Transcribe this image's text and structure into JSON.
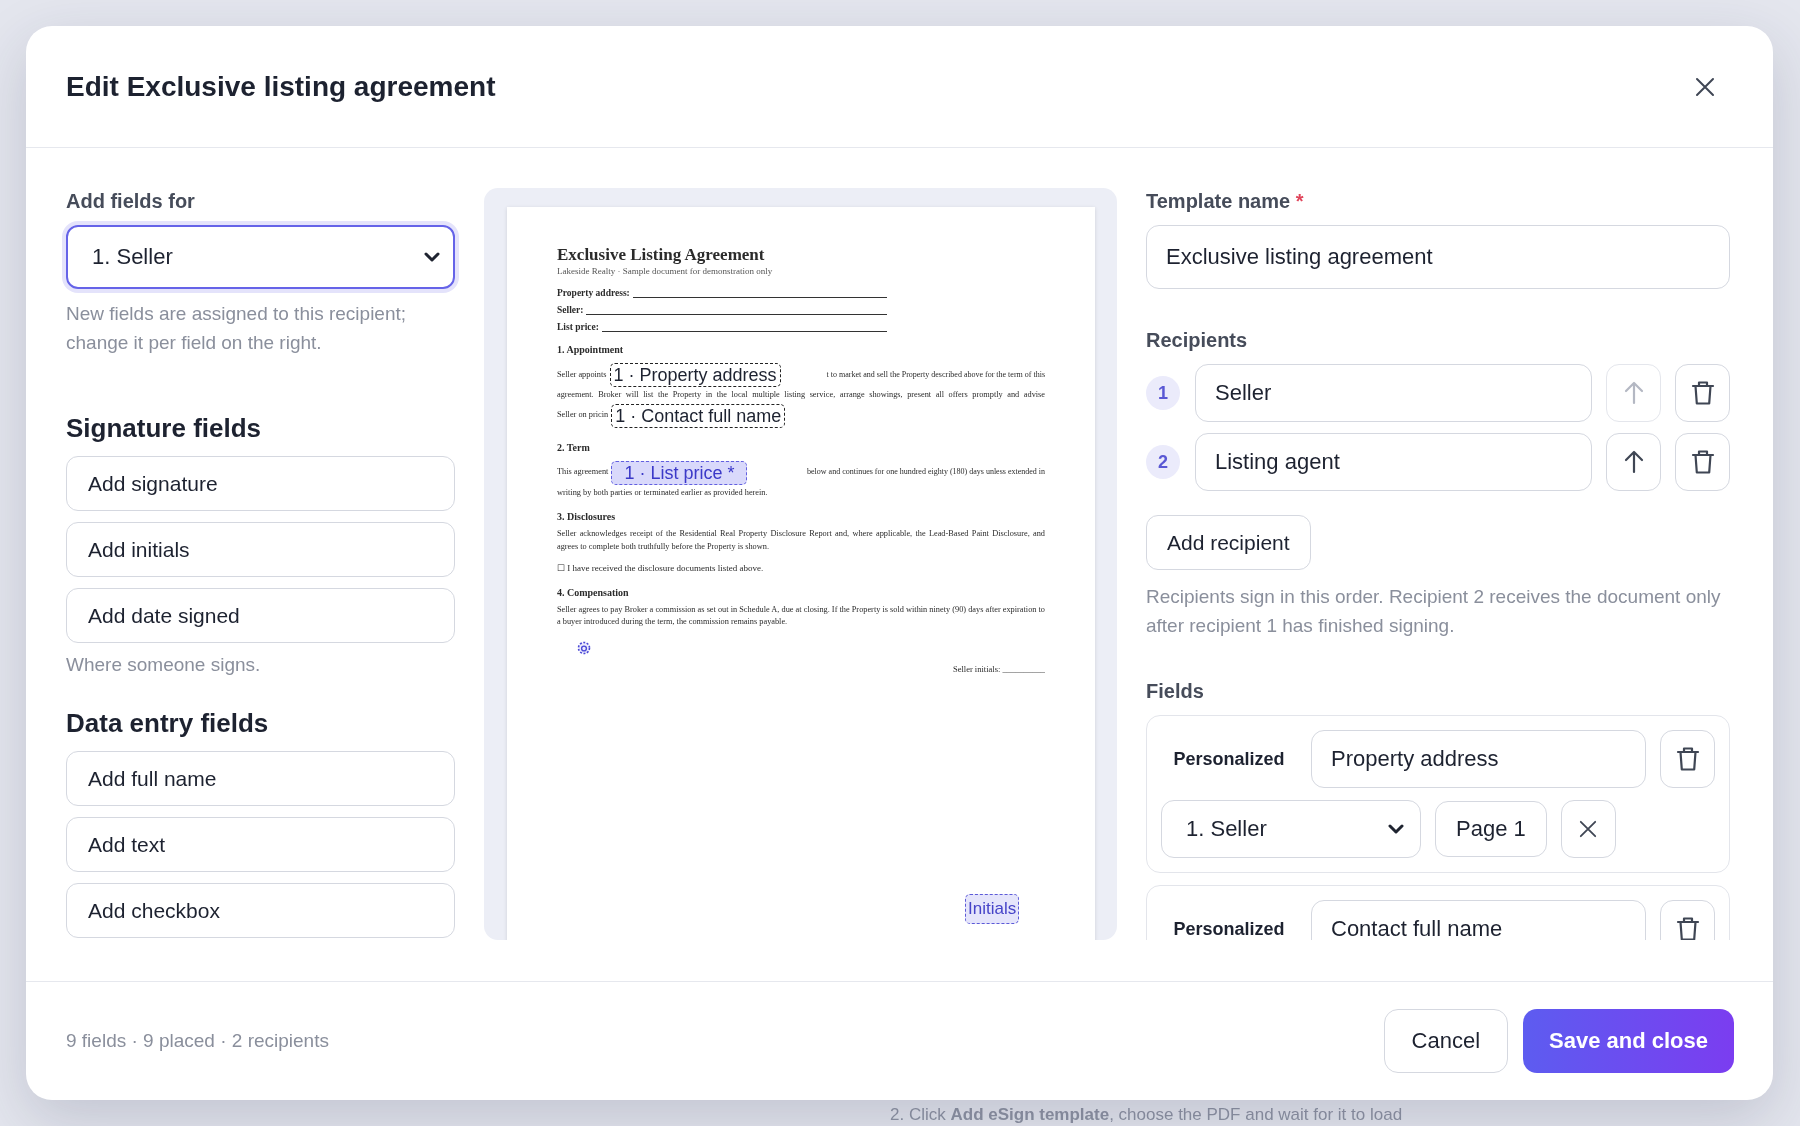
{
  "background": {
    "instruction": "2. Click **Add eSign template**, choose the PDF and wait for it to load"
  },
  "dialog": {
    "title": "Edit Exclusive listing agreement"
  },
  "left_panel": {
    "recipient_label": "Add fields for",
    "recipient_select": "1. Seller",
    "hint": "New fields are assigned to this recipient; change it per field on the right.",
    "sections": [
      {
        "heading": "Signature fields",
        "buttons": [
          "Add signature",
          "Add initials",
          "Add date signed"
        ],
        "note": "Where someone signs."
      },
      {
        "heading": "Data entry fields",
        "buttons": [
          "Add full name",
          "Add text",
          "Add checkbox"
        ]
      }
    ]
  },
  "document": {
    "title": "Exclusive Listing Agreement",
    "subtitle": "Lakeside Realty · Sample document for demonstration only",
    "blanks": [
      "Property address:",
      "Seller:",
      "List price:"
    ],
    "sections": [
      {
        "heading": "1. Appointment",
        "lines": [
          {
            "segments": [
              "Seller appoints",
              "t to market and sell the Property described above for the term of this"
            ],
            "placed_field": {
              "kind": "text",
              "label": "1 · Property address",
              "selected": false
            }
          },
          {
            "segments": [
              "agreement. Broker will list the Property in the local multiple listing service, arrange showings, present all offers promptly and advise"
            ]
          },
          {
            "segments": [
              "Seller on pricin"
            ],
            "placed_field": {
              "kind": "text",
              "label": "1 · Contact full name",
              "selected": false
            }
          }
        ]
      },
      {
        "heading": "2. Term",
        "lines": [
          {
            "segments": [
              "This agreement",
              "below and continues for one hundred eighty (180) days unless extended in"
            ],
            "placed_field": {
              "kind": "text",
              "label": "1 · List price *",
              "selected": true
            }
          },
          {
            "segments": [
              "writing by both parties or terminated earlier as provided herein."
            ]
          }
        ]
      },
      {
        "heading": "3. Disclosures",
        "paragraph": "Seller acknowledges receipt of the Residential Real Property Disclosure Report and, where applicable, the Lead-Based Paint Disclosure, and agrees to complete both truthfully before the Property is shown.",
        "checkbox_line": "☐ I have received the disclosure documents listed above."
      },
      {
        "heading": "4. Compensation",
        "paragraph": "Seller agrees to pay Broker a commission as set out in Schedule A, due at closing. If the Property is sold within ninety (90) days after expiration to a buyer introduced during the term, the commission remains payable."
      }
    ],
    "signature_line": "Seller initials: __________",
    "placed_fields": [
      {
        "kind": "marker",
        "selected": false
      },
      {
        "kind": "initials",
        "label": "Initials",
        "selected": false
      }
    ]
  },
  "right_panel": {
    "template_name": {
      "label": "Template name",
      "required_mark": "*",
      "value": "Exclusive listing agreement"
    },
    "recipients": {
      "label": "Recipients",
      "items": [
        {
          "number": "1",
          "name": "Seller",
          "move_up_disabled": true
        },
        {
          "number": "2",
          "name": "Listing agent",
          "move_up_disabled": false
        }
      ],
      "add_button": "Add recipient",
      "note": "Recipients sign in this order. Recipient 2 receives the document only after recipient 1 has finished signing."
    },
    "fields": {
      "label": "Fields",
      "items": [
        {
          "type_label": "Personalized",
          "name": "Property address",
          "recipient": "1. Seller",
          "page": "Page 1"
        },
        {
          "type_label": "Personalized",
          "name": "Contact full name"
        }
      ]
    }
  },
  "footer": {
    "summary": "9 fields · 9 placed · 2 recipients",
    "cancel": "Cancel",
    "save": "Save and close"
  }
}
